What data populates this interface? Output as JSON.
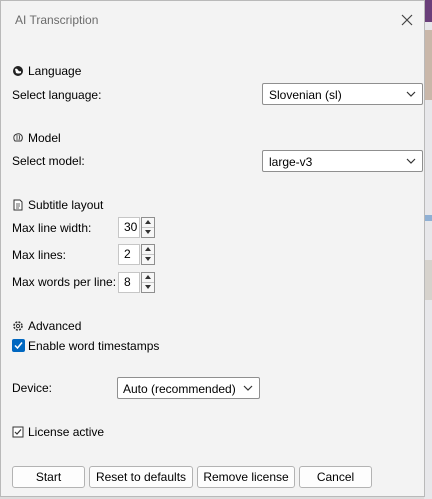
{
  "window": {
    "title": "AI Transcription"
  },
  "language_section": {
    "heading": "Language",
    "select_label": "Select language:",
    "selected": "Slovenian (sl)"
  },
  "model_section": {
    "heading": "Model",
    "select_label": "Select model:",
    "selected": "large-v3"
  },
  "subtitle_section": {
    "heading": "Subtitle layout",
    "max_line_width": {
      "label": "Max line width:",
      "value": "30"
    },
    "max_lines": {
      "label": "Max lines:",
      "value": "2"
    },
    "max_words_per_line": {
      "label": "Max words per line:",
      "value": "8"
    }
  },
  "advanced_section": {
    "heading": "Advanced",
    "word_timestamps": {
      "label": "Enable word timestamps",
      "checked": true
    }
  },
  "device": {
    "label": "Device:",
    "selected": "Auto (recommended)"
  },
  "license": {
    "label": "License active",
    "icon": "checkbox-check-icon"
  },
  "buttons": {
    "start": "Start",
    "reset": "Reset to defaults",
    "remove_license": "Remove license",
    "cancel": "Cancel"
  },
  "colors": {
    "accent": "#0067c0",
    "window_bg": "#f3f3f3"
  }
}
